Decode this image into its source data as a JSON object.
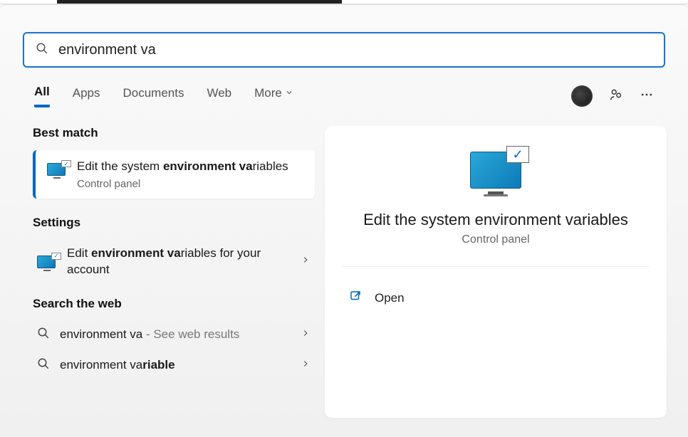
{
  "search": {
    "value": "environment va"
  },
  "tabs": {
    "all": "All",
    "apps": "Apps",
    "documents": "Documents",
    "web": "Web",
    "more": "More"
  },
  "sections": {
    "best_match": "Best match",
    "settings": "Settings",
    "search_web": "Search the web"
  },
  "best_match": {
    "title_prefix": "Edit the system ",
    "title_bold": "environment va",
    "title_suffix": "riables",
    "subtitle": "Control panel"
  },
  "settings_item": {
    "prefix": "Edit ",
    "bold": "environment va",
    "suffix": "riables for your account"
  },
  "web_items": [
    {
      "text": "environment va",
      "suffix": " - See web results"
    },
    {
      "prefix": "environment va",
      "bold": "riable",
      "suffix": ""
    }
  ],
  "preview": {
    "title": "Edit the system environment variables",
    "subtitle": "Control panel",
    "open": "Open"
  }
}
